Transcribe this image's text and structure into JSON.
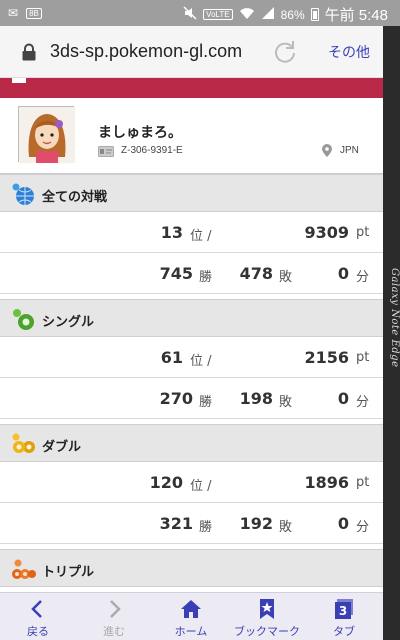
{
  "status_bar": {
    "battery": "86%",
    "time": "午前 5:48",
    "volte": "VoLTE"
  },
  "browser": {
    "url": "3ds-sp.pokemon-gl.com",
    "more_label": "その他"
  },
  "profile": {
    "name": "ましゅまろ。",
    "id": "Z-306-9391-E",
    "region": "JPN"
  },
  "categories": [
    {
      "label": "全ての対戦",
      "icon": "globe-icon",
      "color": "#2f7fd6",
      "rank": "13",
      "rank_unit": "位 /",
      "points": "9309",
      "points_unit": "pt",
      "wins": "745",
      "wins_unit": "勝",
      "losses": "478",
      "losses_unit": "敗",
      "draws": "0",
      "draws_unit": "分"
    },
    {
      "label": "シングル",
      "icon": "single-battle-icon",
      "color": "#4aa32a",
      "rank": "61",
      "rank_unit": "位 /",
      "points": "2156",
      "points_unit": "pt",
      "wins": "270",
      "wins_unit": "勝",
      "losses": "198",
      "losses_unit": "敗",
      "draws": "0",
      "draws_unit": "分"
    },
    {
      "label": "ダブル",
      "icon": "double-battle-icon",
      "color": "#e0a00c",
      "rank": "120",
      "rank_unit": "位 /",
      "points": "1896",
      "points_unit": "pt",
      "wins": "321",
      "wins_unit": "勝",
      "losses": "192",
      "losses_unit": "敗",
      "draws": "0",
      "draws_unit": "分"
    },
    {
      "label": "トリプル",
      "icon": "triple-battle-icon",
      "color": "#e0641a"
    }
  ],
  "bottom_nav": [
    {
      "label": "戻る",
      "icon": "back-icon",
      "enabled": true
    },
    {
      "label": "進む",
      "icon": "forward-icon",
      "enabled": false
    },
    {
      "label": "ホーム",
      "icon": "home-icon",
      "enabled": true
    },
    {
      "label": "ブックマーク",
      "icon": "bookmark-icon",
      "enabled": true
    },
    {
      "label": "タブ",
      "icon": "tabs-icon",
      "enabled": true,
      "badge": "3"
    }
  ],
  "edge_label": "Galaxy Note Edge",
  "colors": {
    "accent": "#3b3fb6",
    "brand_red": "#ba2848"
  }
}
